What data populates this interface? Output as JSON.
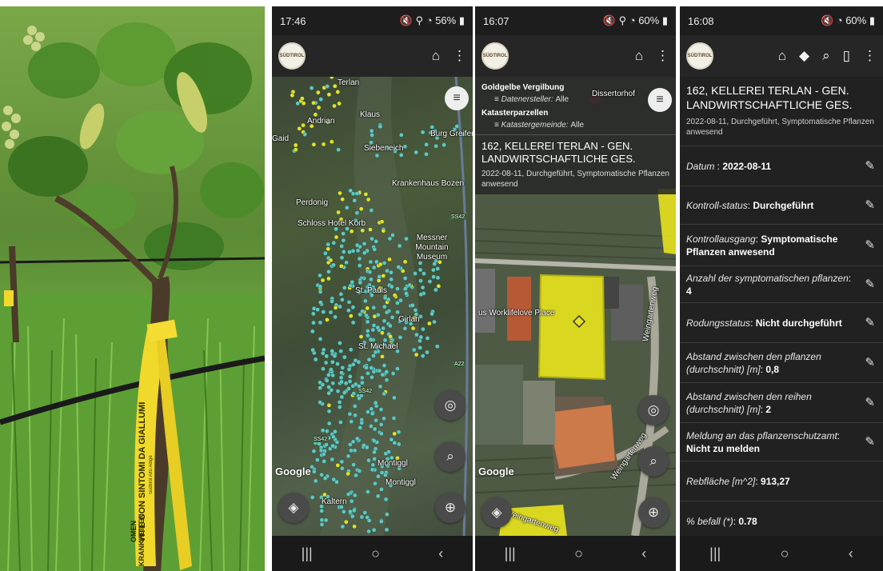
{
  "panel2": {
    "status": {
      "time": "17:46",
      "battery": "56%"
    },
    "labels": [
      "Terlan",
      "Andrian",
      "Klaus",
      "Burg Greifen",
      "Gaid",
      "Siebeneich",
      "Krankenhaus Bozen",
      "Perdonig",
      "Schloss Hotel Korb",
      "Messner Mountain Museum",
      "St. Pauls",
      "Girlan",
      "St. Michael",
      "Montiggl",
      "Montiggl",
      "Kaltern",
      "SS42",
      "SS42",
      "SS42",
      "A22"
    ],
    "google": "Google"
  },
  "panel3": {
    "status": {
      "time": "16:07",
      "battery": "60%"
    },
    "filter1_title": "Goldgelbe Vergilbung",
    "filter1_label": "Datenersteller:",
    "filter1_value": "Alle",
    "filter2_title": "Katasterparzellen",
    "filter2_label": "Katastergemeinde:",
    "filter2_value": "Alle",
    "record_title": "162, KELLEREI TERLAN - GEN. LANDWIRTSCHAFTLICHE GES.",
    "record_desc": "2022-08-11, Durchgeführt, Symptomatische Pflanzen anwesend",
    "labels": [
      "Dissertorhof",
      "us Worklifelove Place",
      "Weingartenweg",
      "Weingartenweg",
      "Weingartenweg"
    ],
    "google": "Google"
  },
  "panel4": {
    "status": {
      "time": "16:08",
      "battery": "60%"
    },
    "title": "162, KELLEREI TERLAN - GEN. LANDWIRTSCHAFTLICHE GES.",
    "desc": "2022-08-11, Durchgeführt, Symptomatische Pflanzen anwesend",
    "rows": [
      {
        "label": "Datum",
        "sep": " : ",
        "value": "2022-08-11"
      },
      {
        "label": "Kontroll-status",
        "sep": ": ",
        "value": "Durchgeführt"
      },
      {
        "label": "Kontrollausgang",
        "sep": ": ",
        "value": "Symptomatische Pflanzen anwesend"
      },
      {
        "label": "Anzahl der symptomatischen pflanzen",
        "sep": ": ",
        "value": "4"
      },
      {
        "label": "Rodungsstatus",
        "sep": ": ",
        "value": "Nicht durchgeführt"
      },
      {
        "label": "Abstand zwischen den pflanzen (durchschnitt) [m]",
        "sep": ": ",
        "value": "0,8"
      },
      {
        "label": "Abstand zwischen den reihen (durchschnitt) [m]",
        "sep": ": ",
        "value": "2"
      },
      {
        "label": "Meldung an das pflanzenschutzamt",
        "sep": ": ",
        "value": "Nicht zu melden"
      },
      {
        "label": "Rebfläche [m^2]",
        "sep": ": ",
        "value": "913,27"
      },
      {
        "label": "% befall (*)",
        "sep": ": ",
        "value": "0.78"
      }
    ]
  },
  "photo": {
    "tape_text_1": "VITE CON SINTOMI DA GIALLUMI",
    "tape_text_2": "KRANKHEITEN",
    "tape_text_3": "OMEN",
    "tape_text_4": "Südtirol Alto Adige"
  },
  "colors": {
    "parcel": "#e6e21e",
    "point": "#5fc8c0",
    "dark": "#212121",
    "tape": "#f1d92b"
  }
}
